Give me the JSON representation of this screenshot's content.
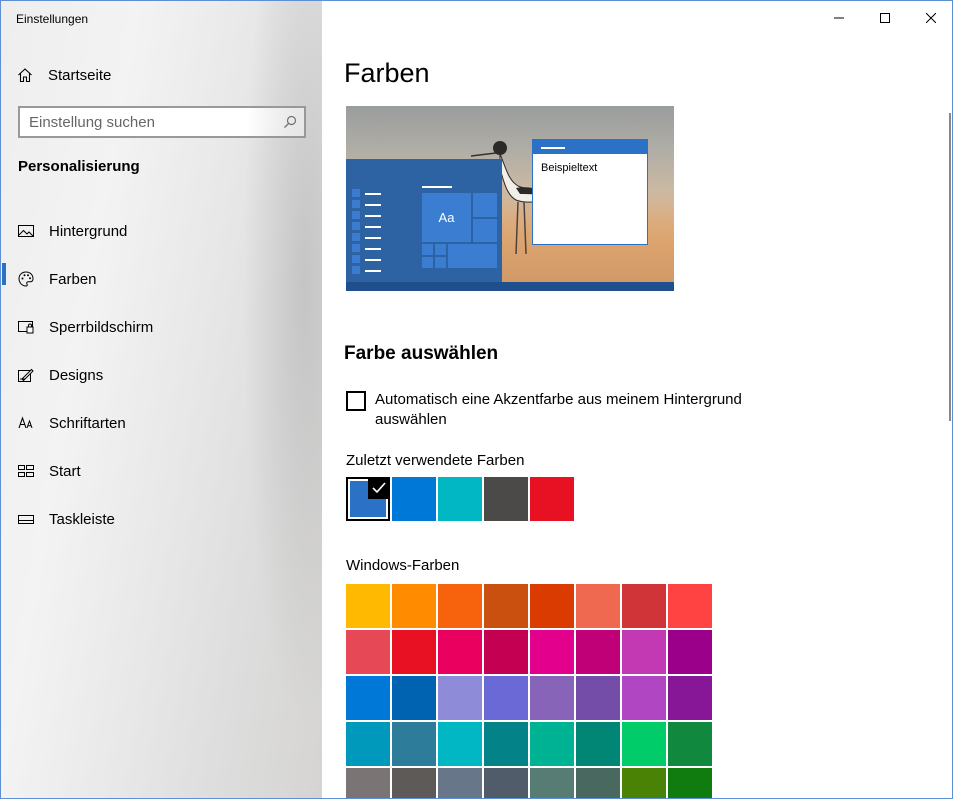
{
  "window": {
    "title": "Einstellungen"
  },
  "sidebar": {
    "home_label": "Startseite",
    "search_placeholder": "Einstellung suchen",
    "section_title": "Personalisierung",
    "items": [
      {
        "label": "Hintergrund",
        "icon": "picture-icon"
      },
      {
        "label": "Farben",
        "icon": "palette-icon",
        "active": true
      },
      {
        "label": "Sperrbildschirm",
        "icon": "lockscreen-icon"
      },
      {
        "label": "Designs",
        "icon": "designs-icon"
      },
      {
        "label": "Schriftarten",
        "icon": "fonts-icon"
      },
      {
        "label": "Start",
        "icon": "start-icon"
      },
      {
        "label": "Taskleiste",
        "icon": "taskbar-icon"
      }
    ]
  },
  "main": {
    "title": "Farben",
    "preview": {
      "tile_label": "Aa",
      "sample_text": "Beispieltext"
    },
    "choose_title": "Farbe auswählen",
    "auto_accent_label": "Automatisch eine Akzentfarbe aus meinem Hintergrund auswählen",
    "auto_accent_checked": false,
    "recent_label": "Zuletzt verwendete Farben",
    "recent_colors": [
      "#2b72c6",
      "#0078d7",
      "#00b7c3",
      "#4c4a48",
      "#e81123"
    ],
    "selected_recent_index": 0,
    "windows_colors_label": "Windows-Farben",
    "windows_colors": [
      "#ffb900",
      "#ff8c00",
      "#f7630c",
      "#ca5010",
      "#da3b01",
      "#ef6950",
      "#d13438",
      "#ff4343",
      "#e74856",
      "#e81123",
      "#ea005e",
      "#c30052",
      "#e3008c",
      "#bf0077",
      "#c239b3",
      "#9a0089",
      "#0078d7",
      "#0063b1",
      "#8e8cd8",
      "#6b69d6",
      "#8764b8",
      "#744da9",
      "#b146c2",
      "#881798",
      "#0099bc",
      "#2d7d9a",
      "#00b7c3",
      "#038387",
      "#00b294",
      "#018574",
      "#00cc6a",
      "#10893e",
      "#7a7574",
      "#5d5a58",
      "#68768a",
      "#515c6b",
      "#567c73",
      "#486860",
      "#498205",
      "#107c10"
    ]
  },
  "colors": {
    "accent": "#2b72c6"
  }
}
